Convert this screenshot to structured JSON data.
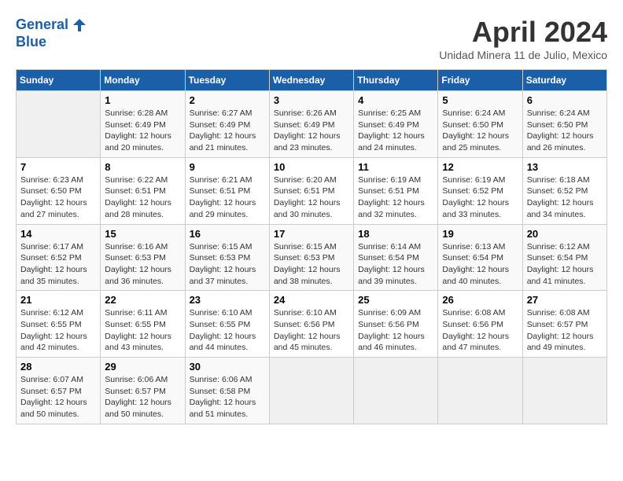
{
  "header": {
    "logo_line1": "General",
    "logo_line2": "Blue",
    "month": "April 2024",
    "location": "Unidad Minera 11 de Julio, Mexico"
  },
  "weekdays": [
    "Sunday",
    "Monday",
    "Tuesday",
    "Wednesday",
    "Thursday",
    "Friday",
    "Saturday"
  ],
  "weeks": [
    [
      {
        "day": "",
        "detail": ""
      },
      {
        "day": "1",
        "detail": "Sunrise: 6:28 AM\nSunset: 6:49 PM\nDaylight: 12 hours\nand 20 minutes."
      },
      {
        "day": "2",
        "detail": "Sunrise: 6:27 AM\nSunset: 6:49 PM\nDaylight: 12 hours\nand 21 minutes."
      },
      {
        "day": "3",
        "detail": "Sunrise: 6:26 AM\nSunset: 6:49 PM\nDaylight: 12 hours\nand 23 minutes."
      },
      {
        "day": "4",
        "detail": "Sunrise: 6:25 AM\nSunset: 6:49 PM\nDaylight: 12 hours\nand 24 minutes."
      },
      {
        "day": "5",
        "detail": "Sunrise: 6:24 AM\nSunset: 6:50 PM\nDaylight: 12 hours\nand 25 minutes."
      },
      {
        "day": "6",
        "detail": "Sunrise: 6:24 AM\nSunset: 6:50 PM\nDaylight: 12 hours\nand 26 minutes."
      }
    ],
    [
      {
        "day": "7",
        "detail": "Sunrise: 6:23 AM\nSunset: 6:50 PM\nDaylight: 12 hours\nand 27 minutes."
      },
      {
        "day": "8",
        "detail": "Sunrise: 6:22 AM\nSunset: 6:51 PM\nDaylight: 12 hours\nand 28 minutes."
      },
      {
        "day": "9",
        "detail": "Sunrise: 6:21 AM\nSunset: 6:51 PM\nDaylight: 12 hours\nand 29 minutes."
      },
      {
        "day": "10",
        "detail": "Sunrise: 6:20 AM\nSunset: 6:51 PM\nDaylight: 12 hours\nand 30 minutes."
      },
      {
        "day": "11",
        "detail": "Sunrise: 6:19 AM\nSunset: 6:51 PM\nDaylight: 12 hours\nand 32 minutes."
      },
      {
        "day": "12",
        "detail": "Sunrise: 6:19 AM\nSunset: 6:52 PM\nDaylight: 12 hours\nand 33 minutes."
      },
      {
        "day": "13",
        "detail": "Sunrise: 6:18 AM\nSunset: 6:52 PM\nDaylight: 12 hours\nand 34 minutes."
      }
    ],
    [
      {
        "day": "14",
        "detail": "Sunrise: 6:17 AM\nSunset: 6:52 PM\nDaylight: 12 hours\nand 35 minutes."
      },
      {
        "day": "15",
        "detail": "Sunrise: 6:16 AM\nSunset: 6:53 PM\nDaylight: 12 hours\nand 36 minutes."
      },
      {
        "day": "16",
        "detail": "Sunrise: 6:15 AM\nSunset: 6:53 PM\nDaylight: 12 hours\nand 37 minutes."
      },
      {
        "day": "17",
        "detail": "Sunrise: 6:15 AM\nSunset: 6:53 PM\nDaylight: 12 hours\nand 38 minutes."
      },
      {
        "day": "18",
        "detail": "Sunrise: 6:14 AM\nSunset: 6:54 PM\nDaylight: 12 hours\nand 39 minutes."
      },
      {
        "day": "19",
        "detail": "Sunrise: 6:13 AM\nSunset: 6:54 PM\nDaylight: 12 hours\nand 40 minutes."
      },
      {
        "day": "20",
        "detail": "Sunrise: 6:12 AM\nSunset: 6:54 PM\nDaylight: 12 hours\nand 41 minutes."
      }
    ],
    [
      {
        "day": "21",
        "detail": "Sunrise: 6:12 AM\nSunset: 6:55 PM\nDaylight: 12 hours\nand 42 minutes."
      },
      {
        "day": "22",
        "detail": "Sunrise: 6:11 AM\nSunset: 6:55 PM\nDaylight: 12 hours\nand 43 minutes."
      },
      {
        "day": "23",
        "detail": "Sunrise: 6:10 AM\nSunset: 6:55 PM\nDaylight: 12 hours\nand 44 minutes."
      },
      {
        "day": "24",
        "detail": "Sunrise: 6:10 AM\nSunset: 6:56 PM\nDaylight: 12 hours\nand 45 minutes."
      },
      {
        "day": "25",
        "detail": "Sunrise: 6:09 AM\nSunset: 6:56 PM\nDaylight: 12 hours\nand 46 minutes."
      },
      {
        "day": "26",
        "detail": "Sunrise: 6:08 AM\nSunset: 6:56 PM\nDaylight: 12 hours\nand 47 minutes."
      },
      {
        "day": "27",
        "detail": "Sunrise: 6:08 AM\nSunset: 6:57 PM\nDaylight: 12 hours\nand 49 minutes."
      }
    ],
    [
      {
        "day": "28",
        "detail": "Sunrise: 6:07 AM\nSunset: 6:57 PM\nDaylight: 12 hours\nand 50 minutes."
      },
      {
        "day": "29",
        "detail": "Sunrise: 6:06 AM\nSunset: 6:57 PM\nDaylight: 12 hours\nand 50 minutes."
      },
      {
        "day": "30",
        "detail": "Sunrise: 6:06 AM\nSunset: 6:58 PM\nDaylight: 12 hours\nand 51 minutes."
      },
      {
        "day": "",
        "detail": ""
      },
      {
        "day": "",
        "detail": ""
      },
      {
        "day": "",
        "detail": ""
      },
      {
        "day": "",
        "detail": ""
      }
    ]
  ]
}
